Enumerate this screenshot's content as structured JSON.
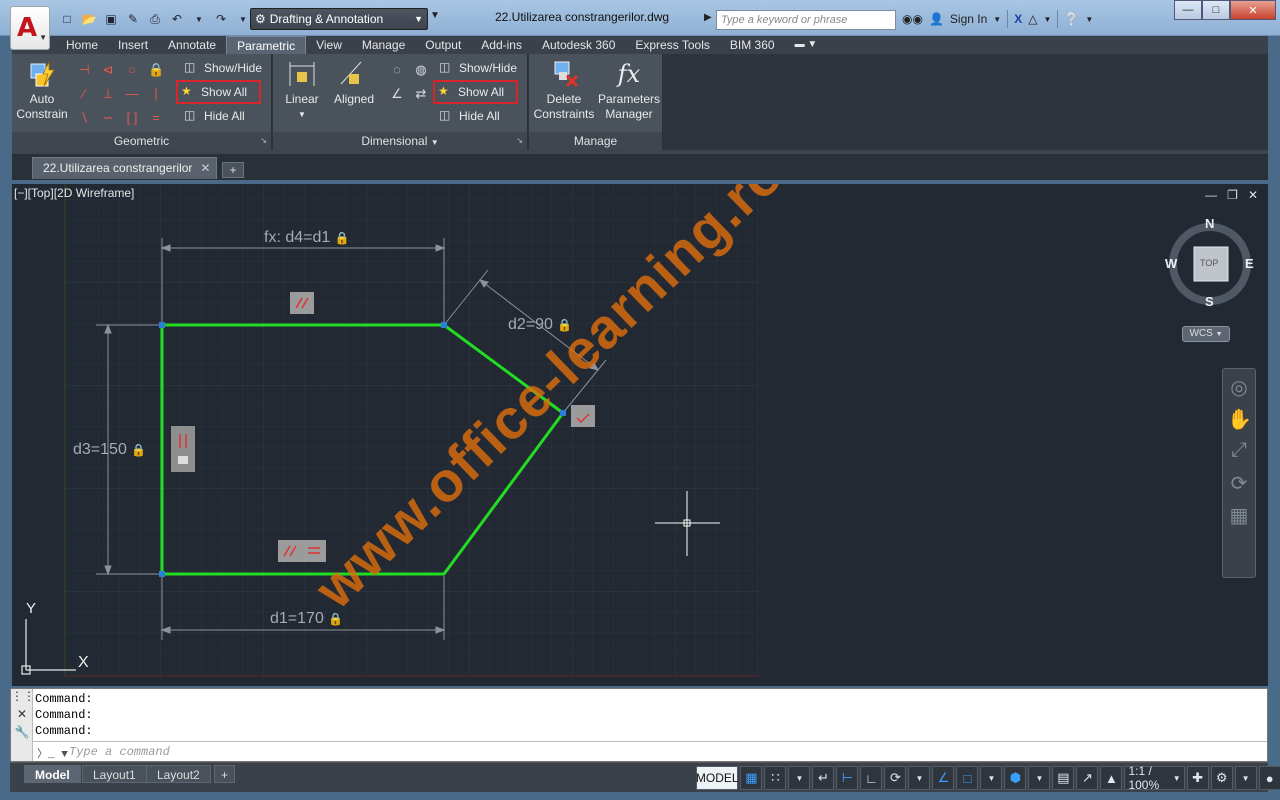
{
  "app": {
    "logo": "A",
    "doc_title": "22.Utilizarea constrangerilor.dwg"
  },
  "workspace": "Drafting & Annotation",
  "search": {
    "placeholder": "Type a keyword or phrase"
  },
  "account": {
    "sign_in": "Sign In"
  },
  "ribbon_tabs": [
    "Home",
    "Insert",
    "Annotate",
    "Parametric",
    "View",
    "Manage",
    "Output",
    "Add-ins",
    "Autodesk 360",
    "Express Tools",
    "BIM 360"
  ],
  "ribbon": {
    "geometric": {
      "title": "Geometric",
      "auto_constrain": [
        "Auto",
        "Constrain"
      ],
      "show_hide": "Show/Hide",
      "show_all": "Show All",
      "hide_all": "Hide All"
    },
    "dimensional": {
      "title": "Dimensional",
      "linear": "Linear",
      "aligned": "Aligned",
      "show_hide": "Show/Hide",
      "show_all": "Show All",
      "hide_all": "Hide All"
    },
    "manage": {
      "title": "Manage",
      "delete_constraints": [
        "Delete",
        "Constraints"
      ],
      "parameters_manager": [
        "Parameters",
        "Manager"
      ],
      "fx": "fx"
    }
  },
  "file_tab": {
    "label": "22.Utilizarea constrangerilor",
    "new": "+"
  },
  "viewport": {
    "label": "[−][Top][2D Wireframe]",
    "dims": {
      "d4": "fx: d4=d1",
      "d2": "d2=90",
      "d3": "d3=150",
      "d1": "d1=170"
    },
    "ucs": {
      "x": "X",
      "y": "Y"
    },
    "viewcube": {
      "n": "N",
      "s": "S",
      "e": "E",
      "w": "W",
      "top": "TOP",
      "wcs": "WCS"
    },
    "watermark": "www.office-learning.ro"
  },
  "command": {
    "history": [
      "Command:",
      "Command:",
      "Command:"
    ],
    "placeholder": "Type a command"
  },
  "layout_tabs": [
    "Model",
    "Layout1",
    "Layout2"
  ],
  "status": {
    "model": "MODEL",
    "scale": "1:1 / 100%"
  },
  "colors": {
    "geometry": "#22dd22",
    "background": "#222933",
    "watermark": "#e06e0c",
    "highlight": "#d6262c"
  }
}
